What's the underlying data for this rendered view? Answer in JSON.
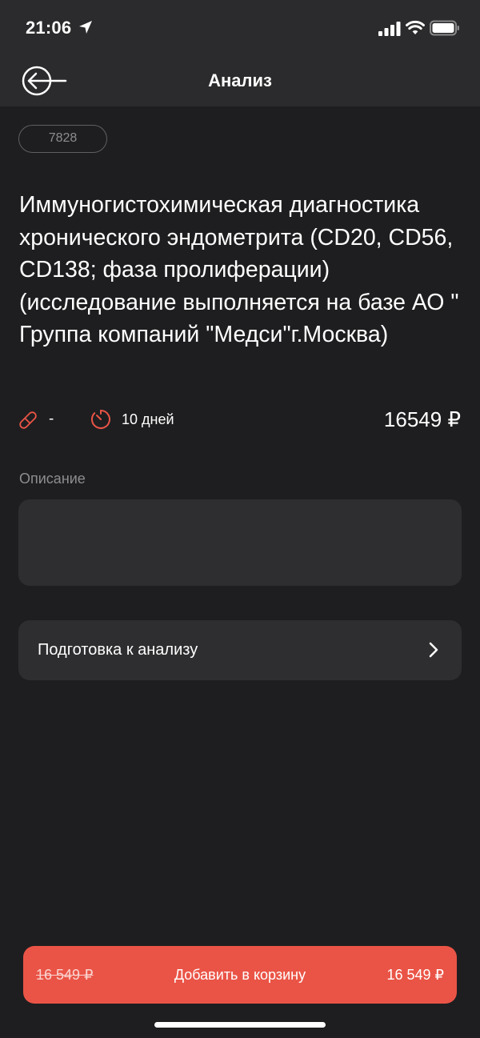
{
  "status_bar": {
    "time": "21:06",
    "icons": [
      "location-arrow-icon",
      "signal-icon",
      "wifi-icon",
      "battery-icon"
    ]
  },
  "header": {
    "title": "Анализ",
    "back_icon": "arrow-left-circle-icon"
  },
  "analysis": {
    "code": "7828",
    "title": "Иммуногистохимическая диагностика хронического эндометрита (CD20, CD56, CD138; фаза пролиферации) (исследование выполняется на базе АО \" Группа компаний \"Медси\"г.Москва)",
    "tube_value": "-",
    "duration": "10 дней",
    "price": "16549 ₽"
  },
  "description": {
    "label": "Описание",
    "text": ""
  },
  "preparation": {
    "label": "Подготовка к анализу"
  },
  "cart_button": {
    "old_price": "16 549 ₽",
    "label": "Добавить в корзину",
    "price": "16 549 ₽"
  },
  "colors": {
    "background": "#1e1e20",
    "header": "#2b2b2d",
    "card": "#2e2e30",
    "accent": "#ea5446",
    "muted_text": "#8d8d90"
  }
}
